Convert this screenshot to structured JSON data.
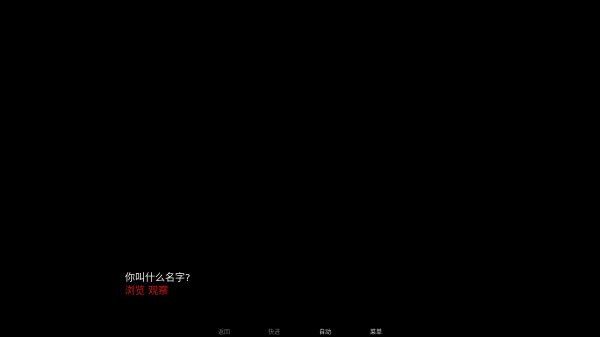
{
  "dialogue": {
    "text": "你叫什么名字?",
    "choice": "浏览 观察"
  },
  "quick_menu": [
    {
      "label": "返回"
    },
    {
      "label": "快进"
    },
    {
      "label": "自动"
    },
    {
      "label": "菜单"
    }
  ],
  "colors": {
    "background": "#000000",
    "dialogue_text": "#e8e8e8",
    "choice_text": "#d41818",
    "menu_dim": "#6a6a6a",
    "menu_bright": "#cfcfcf"
  }
}
